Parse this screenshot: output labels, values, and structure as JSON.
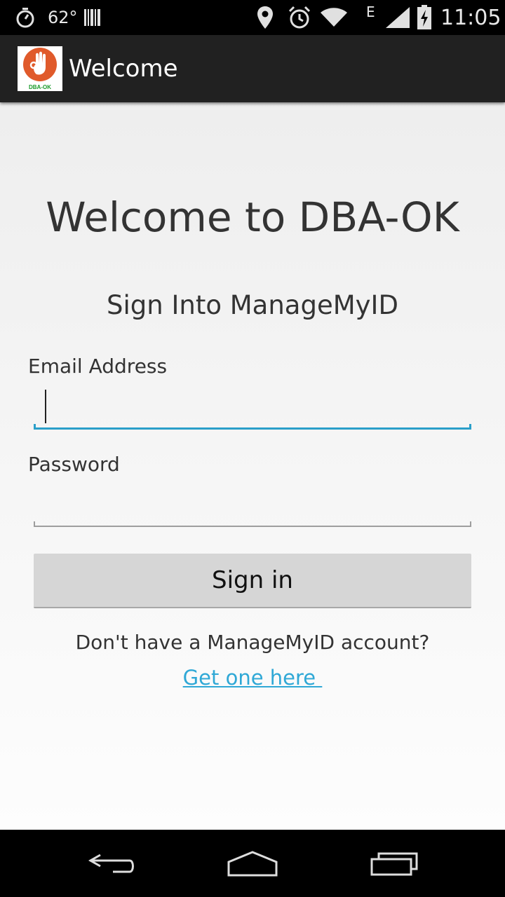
{
  "status_bar": {
    "temperature": "62°",
    "network_type": "E",
    "time": "11:05",
    "icons": [
      "stopwatch-icon",
      "barcode-icon",
      "location-icon",
      "alarm-icon",
      "wifi-icon",
      "signal-icon",
      "battery-charging-icon"
    ]
  },
  "action_bar": {
    "title": "Welcome",
    "logo_text": "DBA-OK",
    "logo_color": "#e05a2b",
    "logo_text_color": "#1a9a2a"
  },
  "main": {
    "heading": "Welcome to DBA-OK",
    "subheading": "Sign Into ManageMyID",
    "email_label": "Email Address",
    "email_value": "",
    "password_label": "Password",
    "password_value": "",
    "signin_label": "Sign in",
    "no_account_text": "Don't have a ManageMyID account?",
    "get_one_link": "Get one here "
  },
  "colors": {
    "accent": "#2a9fc9",
    "link": "#2fa8d6",
    "action_bar_bg": "#212121"
  },
  "nav_bar": {
    "icons": [
      "back-icon",
      "home-icon",
      "recent-apps-icon"
    ]
  }
}
